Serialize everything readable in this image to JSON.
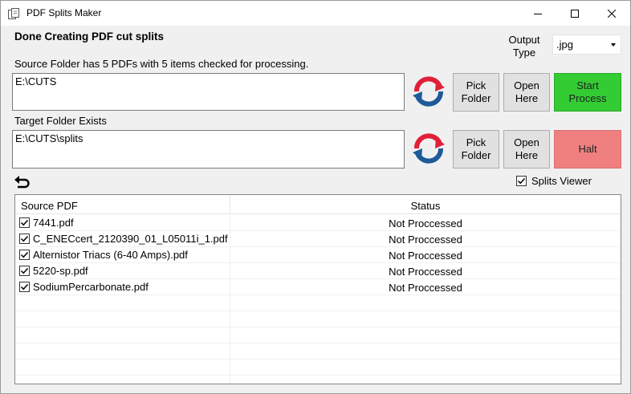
{
  "window": {
    "title": "PDF Splits Maker"
  },
  "status_message": "Done Creating PDF cut splits",
  "output_type": {
    "label": "Output Type",
    "value": ".jpg"
  },
  "source": {
    "info": "Source Folder has 5 PDFs with 5 items checked for processing.",
    "path": "E:\\CUTS",
    "pick_label": "Pick\nFolder",
    "open_label": "Open\nHere"
  },
  "target": {
    "info": "Target Folder Exists",
    "path": "E:\\CUTS\\splits",
    "pick_label": "Pick\nFolder",
    "open_label": "Open\nHere"
  },
  "start_label": "Start\nProcess",
  "halt_label": "Halt",
  "splits_viewer": {
    "label": "Splits Viewer",
    "checked": true
  },
  "colors": {
    "start": "#33cc33",
    "halt": "#f08080"
  },
  "list": {
    "columns": [
      "Source PDF",
      "Status"
    ],
    "rows": [
      {
        "file": "7441.pdf",
        "status": "Not Proccessed",
        "checked": true
      },
      {
        "file": "C_ENECcert_2120390_01_L05011i_1.pdf",
        "status": "Not Proccessed",
        "checked": true
      },
      {
        "file": "Alternistor Triacs (6-40 Amps).pdf",
        "status": "Not Proccessed",
        "checked": true
      },
      {
        "file": "5220-sp.pdf",
        "status": "Not Proccessed",
        "checked": true
      },
      {
        "file": "SodiumPercarbonate.pdf",
        "status": "Not Proccessed",
        "checked": true
      }
    ]
  }
}
